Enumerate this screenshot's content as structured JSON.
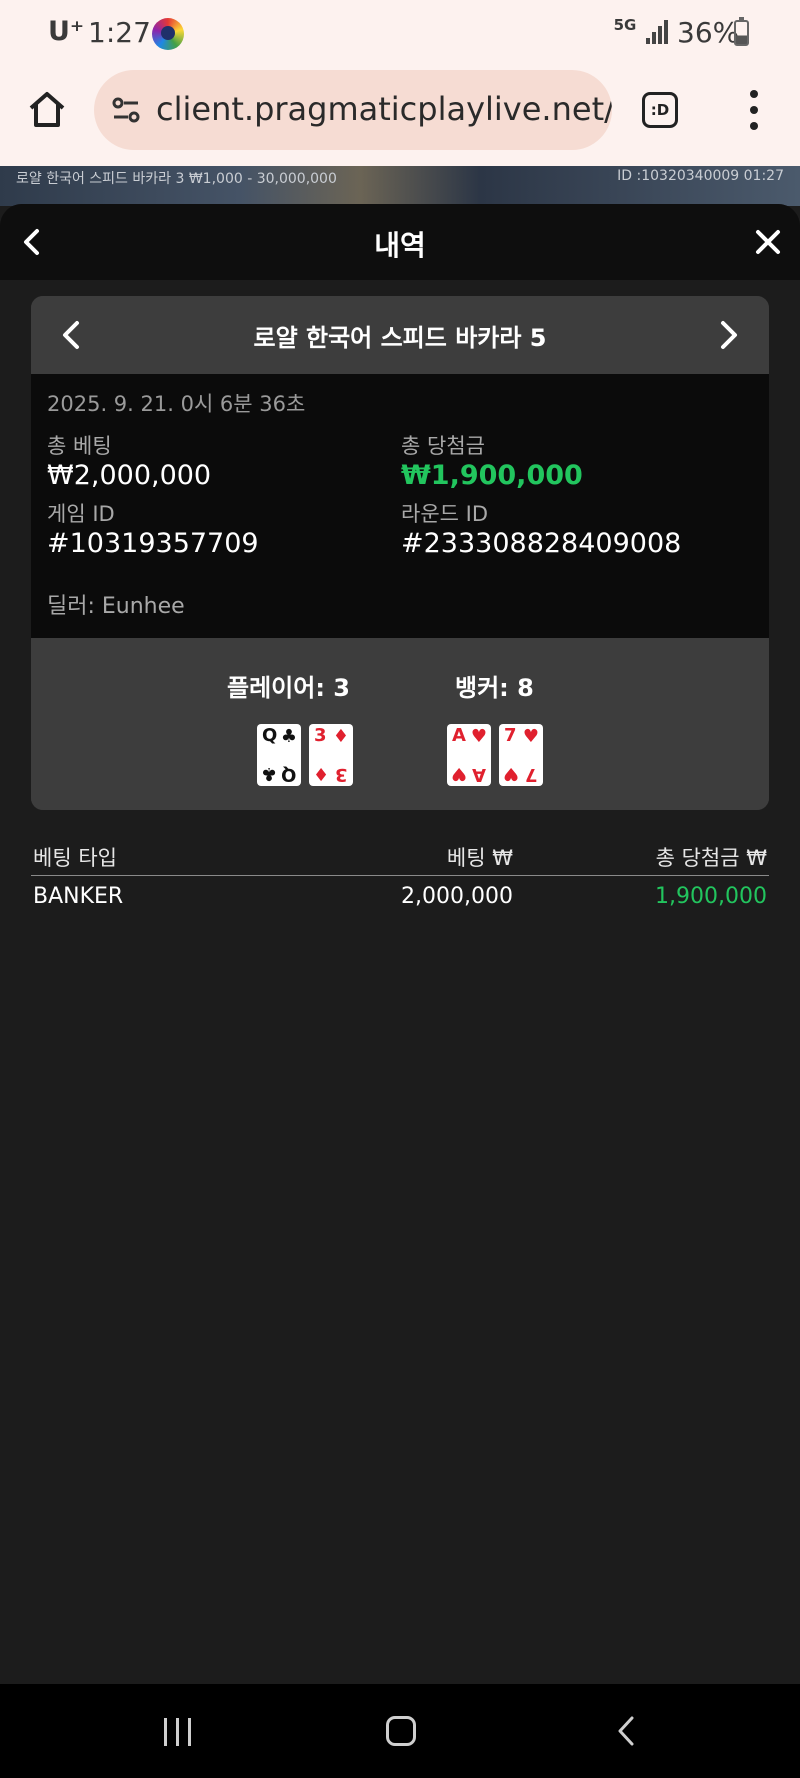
{
  "status_bar": {
    "carrier": "U⁺",
    "time": "1:27",
    "network": "5G",
    "battery": "36%"
  },
  "browser": {
    "url": "client.pragmaticplaylive.net/c",
    "tab_label": ":D"
  },
  "game_strip": {
    "left_text": "로얄 한국어 스피드 바카라 3 ₩1,000 - 30,000,000",
    "right_text": "ID :10320340009 01:27"
  },
  "sheet": {
    "title": "내역"
  },
  "round": {
    "title": "로얄 한국어 스피드 바카라 5",
    "datetime": "2025. 9. 21. 0시 6분 36초",
    "total_bet_label": "총 베팅",
    "total_bet": "₩2,000,000",
    "total_win_label": "총 당첨금",
    "total_win": "₩1,900,000",
    "game_id_label": "게임 ID",
    "game_id": "#10319357709",
    "round_id_label": "라운드 ID",
    "round_id": "#233308828409008",
    "dealer": "딜러: Eunhee"
  },
  "result": {
    "player_label": "플레이어: 3",
    "banker_label": "뱅커: 8",
    "player_cards": [
      {
        "rank": "Q",
        "suit": "♣",
        "color": "#111111"
      },
      {
        "rank": "3",
        "suit": "♦",
        "color": "#e0202e"
      }
    ],
    "banker_cards": [
      {
        "rank": "A",
        "suit": "♥",
        "color": "#e0202e"
      },
      {
        "rank": "7",
        "suit": "♥",
        "color": "#e0202e"
      }
    ]
  },
  "bets_table": {
    "headers": [
      "베팅 타입",
      "베팅 ₩",
      "총 당첨금 ₩"
    ],
    "rows": [
      {
        "type": "BANKER",
        "bet": "2,000,000",
        "win": "1,900,000"
      }
    ]
  },
  "colors": {
    "win_green": "#22c55e",
    "accent_bg": "#3d3d3d"
  }
}
